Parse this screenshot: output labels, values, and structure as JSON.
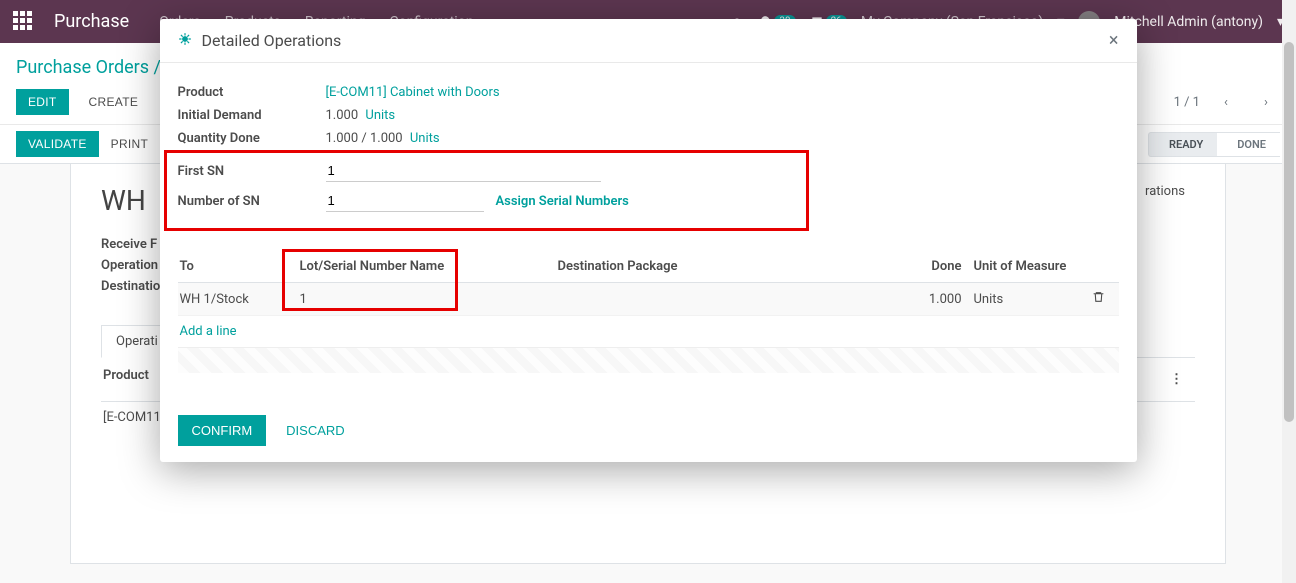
{
  "navbar": {
    "brand": "Purchase",
    "menus": [
      "Orders",
      "Products",
      "Reporting",
      "Configuration"
    ],
    "badge1": "38",
    "badge2": "26",
    "company": "My Company (San Francisco)",
    "user": "Mitchell Admin (antony)"
  },
  "breadcrumb": "Purchase Orders /",
  "buttons": {
    "edit": "EDIT",
    "create": "CREATE",
    "validate": "VALIDATE",
    "print": "PRINT",
    "confirm": "CONFIRM",
    "discard": "DISCARD"
  },
  "pager": {
    "text": "1 / 1"
  },
  "status": {
    "ready": "READY",
    "done": "DONE"
  },
  "form": {
    "title_prefix": "WH",
    "receive": "Receive F",
    "operation": "Operation",
    "destination": "Destination",
    "tab_ops": "Operati",
    "th_product": "Product",
    "row_product": "[E-COM11"
  },
  "modal": {
    "title": "Detailed Operations",
    "fields": {
      "product_label": "Product",
      "product_value": "[E-COM11] Cabinet with Doors",
      "initial_demand_label": "Initial Demand",
      "initial_demand_qty": "1.000",
      "initial_demand_uom": "Units",
      "quantity_done_label": "Quantity Done",
      "quantity_done_val": "1.000 / 1.000",
      "quantity_done_uom": "Units",
      "first_sn_label": "First SN",
      "first_sn_value": "1",
      "number_sn_label": "Number of SN",
      "number_sn_value": "1",
      "assign_label": "Assign Serial Numbers"
    },
    "table": {
      "th_to": "To",
      "th_lot": "Lot/Serial Number Name",
      "th_dest": "Destination Package",
      "th_done": "Done",
      "th_uom": "Unit of Measure",
      "row1_to": "WH 1/Stock",
      "row1_lot": "1",
      "row1_done": "1.000",
      "row1_uom": "Units",
      "add_line": "Add a line"
    }
  }
}
